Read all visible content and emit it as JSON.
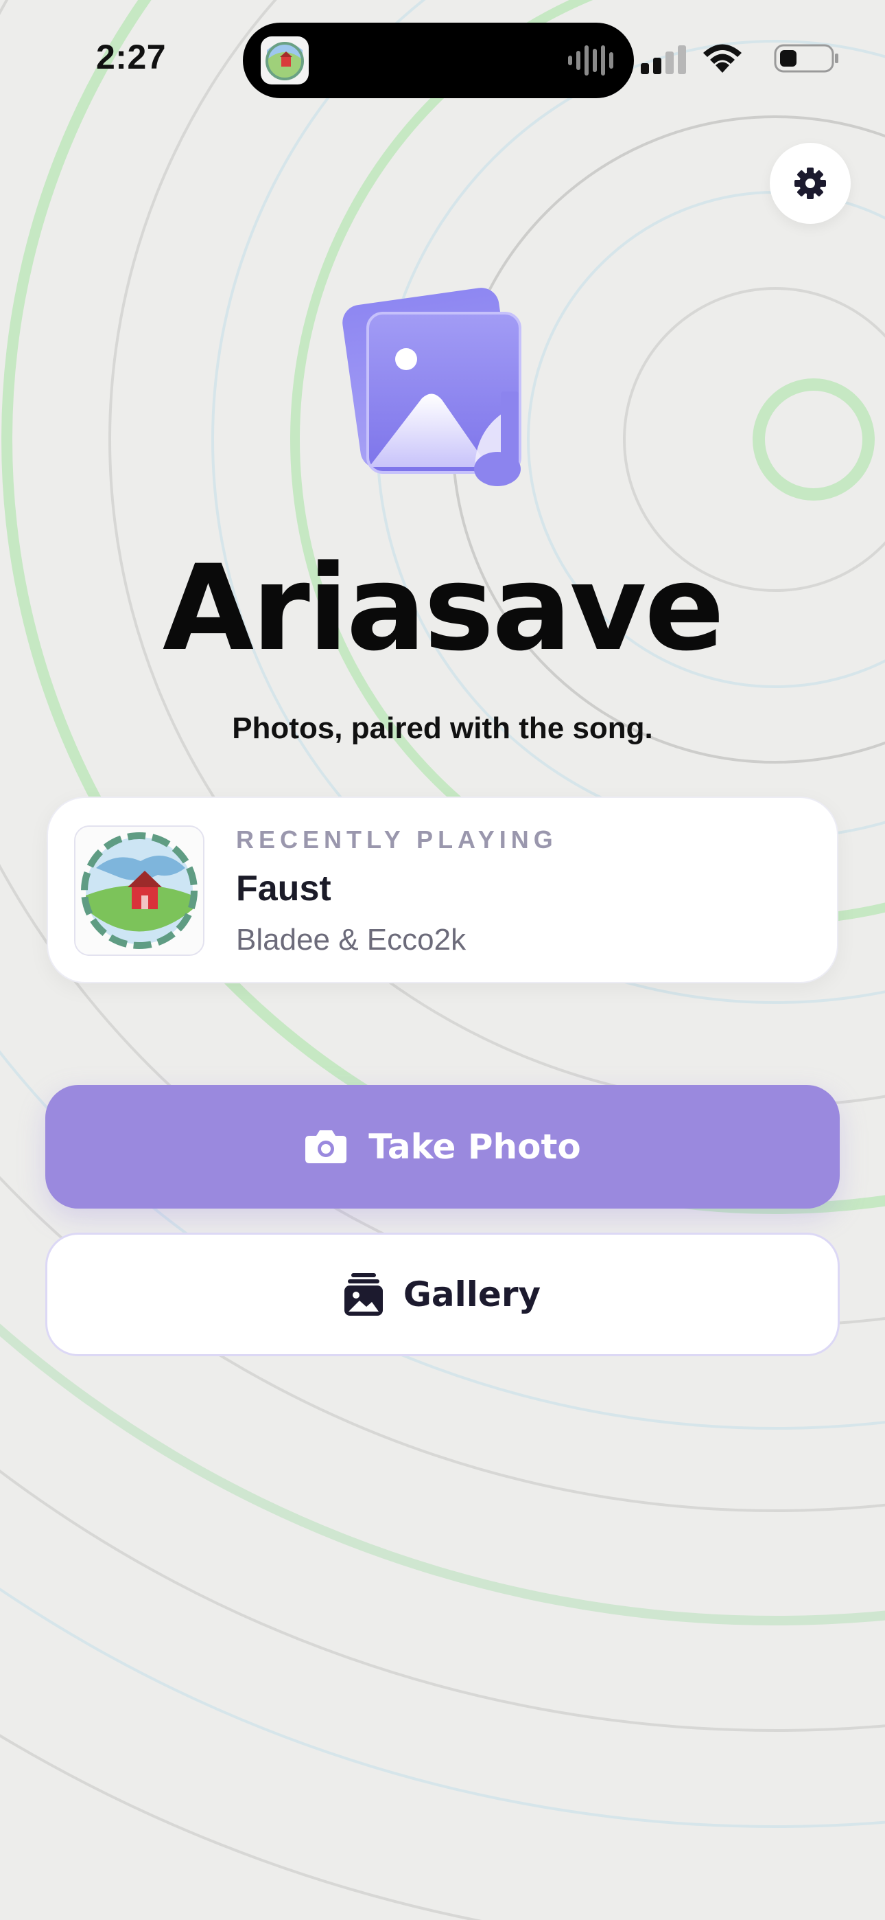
{
  "status_bar": {
    "time": "2:27",
    "icons": [
      "app-activity-icon",
      "audio-waveform-icon",
      "cellular-signal-icon",
      "wifi-icon",
      "battery-icon"
    ]
  },
  "header": {
    "settings_icon": "gear-icon"
  },
  "hero": {
    "logo_icon": "photo-music-note-logo",
    "title": "Ariasave",
    "tagline": "Photos, paired with the song."
  },
  "now_playing": {
    "eyebrow": "RECENTLY PLAYING",
    "title": "Faust",
    "artist": "Bladee & Ecco2k"
  },
  "actions": {
    "take_photo": {
      "label": "Take Photo",
      "icon": "camera-icon"
    },
    "gallery": {
      "label": "Gallery",
      "icon": "gallery-stack-icon"
    }
  },
  "colors": {
    "background": "#ededeb",
    "accent_purple": "#9a89de",
    "logo_purple": "#8f86ee",
    "ring_green": "#bfe4bb",
    "ring_blue": "#cfe2e8",
    "card": "#ffffff"
  }
}
